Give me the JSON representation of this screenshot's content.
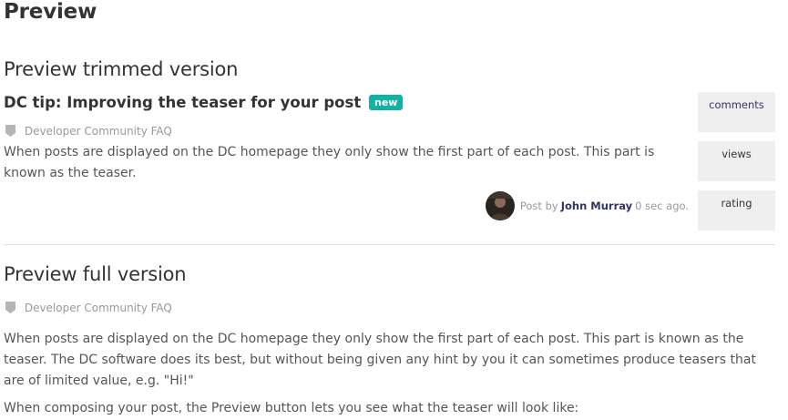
{
  "page": {
    "title": "Preview"
  },
  "trimmed": {
    "section_title": "Preview trimmed version",
    "post_title": "DC tip: Improving the teaser for your post",
    "badge": "new",
    "category": "Developer Community FAQ",
    "teaser": "When posts are displayed on the DC homepage they only show the first part of each post. This part is known as the teaser.",
    "byline_prefix": "Post by",
    "author": "John Murray",
    "time_ago": "0 sec ago.",
    "stats": {
      "comments": "comments",
      "views": "views",
      "rating": "rating"
    }
  },
  "full": {
    "section_title": "Preview full version",
    "category": "Developer Community FAQ",
    "paragraphs": [
      "When posts are displayed on the DC homepage they only show the first part of each post. This part is known as the teaser. The DC software does its best, but without being given any hint by you it can sometimes produce teasers that are of limited value, e.g. \"Hi!\"",
      "When composing your post, the Preview button lets you see what the teaser will look like:"
    ]
  },
  "colors": {
    "badge": "#12b1a4",
    "link": "#333366",
    "muted": "#999999",
    "stat_box": "#efefef"
  },
  "icons": {
    "category": "tag-icon",
    "avatar": "user-avatar"
  }
}
